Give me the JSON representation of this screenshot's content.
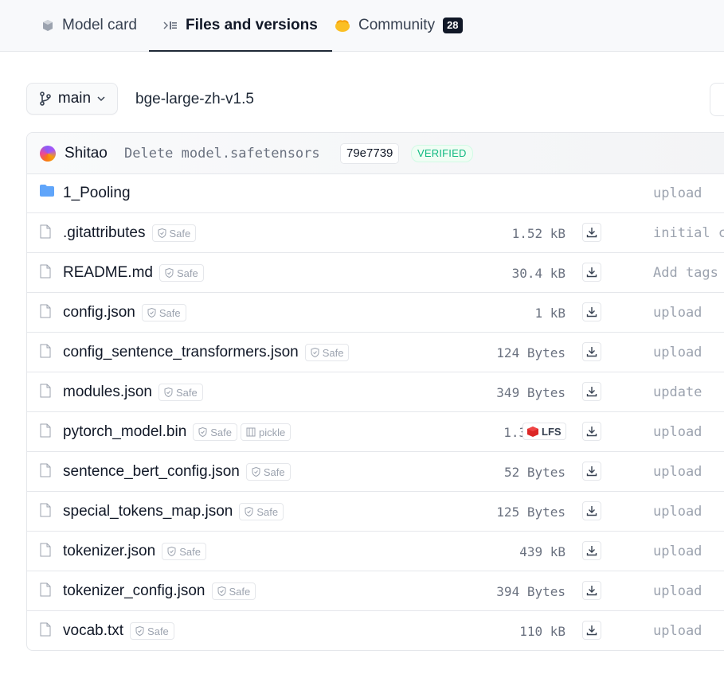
{
  "tabs": [
    {
      "label": "Model card"
    },
    {
      "label": "Files and versions"
    },
    {
      "label": "Community",
      "count": "28"
    }
  ],
  "branch": {
    "label": "main"
  },
  "repo": {
    "path": "bge-large-zh-v1.5"
  },
  "commit": {
    "user": "Shitao",
    "message": "Delete model.safetensors",
    "hash": "79e7739",
    "status": "VERIFIED"
  },
  "files": [
    {
      "name": "1_Pooling",
      "type": "folder",
      "size": "",
      "message": "upload"
    },
    {
      "name": ".gitattributes",
      "type": "file",
      "safe": "Safe",
      "size": "1.52 kB",
      "message": "initial c"
    },
    {
      "name": "README.md",
      "type": "file",
      "safe": "Safe",
      "size": "30.4 kB",
      "message": "Add tags"
    },
    {
      "name": "config.json",
      "type": "file",
      "safe": "Safe",
      "size": "1 kB",
      "message": "upload"
    },
    {
      "name": "config_sentence_transformers.json",
      "type": "file",
      "safe": "Safe",
      "size": "124 Bytes",
      "message": "upload"
    },
    {
      "name": "modules.json",
      "type": "file",
      "safe": "Safe",
      "size": "349 Bytes",
      "message": "update"
    },
    {
      "name": "pytorch_model.bin",
      "type": "file",
      "safe": "Safe",
      "extra": "pickle",
      "size": "1.3 GB",
      "lfs": "LFS",
      "message": "upload"
    },
    {
      "name": "sentence_bert_config.json",
      "type": "file",
      "safe": "Safe",
      "size": "52 Bytes",
      "message": "upload"
    },
    {
      "name": "special_tokens_map.json",
      "type": "file",
      "safe": "Safe",
      "size": "125 Bytes",
      "message": "upload"
    },
    {
      "name": "tokenizer.json",
      "type": "file",
      "safe": "Safe",
      "size": "439 kB",
      "message": "upload"
    },
    {
      "name": "tokenizer_config.json",
      "type": "file",
      "safe": "Safe",
      "size": "394 Bytes",
      "message": "upload"
    },
    {
      "name": "vocab.txt",
      "type": "file",
      "safe": "Safe",
      "size": "110 kB",
      "message": "upload"
    }
  ],
  "colors": {
    "folder": "#60a5fa",
    "verified": "#10b981",
    "lfs": "#dc2626"
  }
}
